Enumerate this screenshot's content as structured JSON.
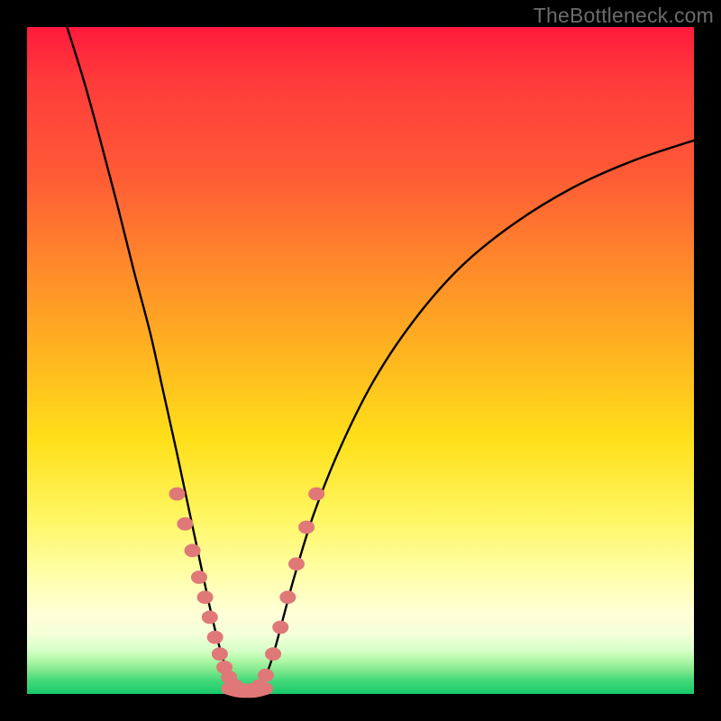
{
  "watermark": "TheBottleneck.com",
  "chart_data": {
    "type": "line",
    "title": "",
    "xlabel": "",
    "ylabel": "",
    "xlim": [
      0,
      1
    ],
    "ylim": [
      0,
      1
    ],
    "gradient_stops": [
      {
        "pos": 0.0,
        "color": "#ff1a3c"
      },
      {
        "pos": 0.22,
        "color": "#ff5a36"
      },
      {
        "pos": 0.5,
        "color": "#ffb81f"
      },
      {
        "pos": 0.73,
        "color": "#fff55e"
      },
      {
        "pos": 0.91,
        "color": "#f4ffd8"
      },
      {
        "pos": 1.0,
        "color": "#18c96a"
      }
    ],
    "series": [
      {
        "name": "left-curve",
        "points": [
          {
            "x": 0.06,
            "y": 1.0
          },
          {
            "x": 0.085,
            "y": 0.92
          },
          {
            "x": 0.11,
            "y": 0.83
          },
          {
            "x": 0.135,
            "y": 0.735
          },
          {
            "x": 0.16,
            "y": 0.635
          },
          {
            "x": 0.185,
            "y": 0.54
          },
          {
            "x": 0.205,
            "y": 0.45
          },
          {
            "x": 0.225,
            "y": 0.36
          },
          {
            "x": 0.242,
            "y": 0.28
          },
          {
            "x": 0.258,
            "y": 0.205
          },
          {
            "x": 0.273,
            "y": 0.135
          },
          {
            "x": 0.286,
            "y": 0.08
          },
          {
            "x": 0.298,
            "y": 0.04
          },
          {
            "x": 0.31,
            "y": 0.015
          },
          {
            "x": 0.322,
            "y": 0.005
          }
        ]
      },
      {
        "name": "right-curve",
        "points": [
          {
            "x": 0.345,
            "y": 0.005
          },
          {
            "x": 0.355,
            "y": 0.02
          },
          {
            "x": 0.368,
            "y": 0.055
          },
          {
            "x": 0.383,
            "y": 0.11
          },
          {
            "x": 0.402,
            "y": 0.18
          },
          {
            "x": 0.43,
            "y": 0.27
          },
          {
            "x": 0.47,
            "y": 0.37
          },
          {
            "x": 0.52,
            "y": 0.47
          },
          {
            "x": 0.58,
            "y": 0.56
          },
          {
            "x": 0.65,
            "y": 0.64
          },
          {
            "x": 0.73,
            "y": 0.705
          },
          {
            "x": 0.82,
            "y": 0.76
          },
          {
            "x": 0.91,
            "y": 0.8
          },
          {
            "x": 1.0,
            "y": 0.83
          }
        ]
      },
      {
        "name": "bottom-flat",
        "points": [
          {
            "x": 0.3,
            "y": 0.008
          },
          {
            "x": 0.315,
            "y": 0.004
          },
          {
            "x": 0.33,
            "y": 0.003
          },
          {
            "x": 0.345,
            "y": 0.004
          },
          {
            "x": 0.36,
            "y": 0.008
          }
        ]
      }
    ],
    "markers": {
      "name": "highlight-dots",
      "color": "#e07878",
      "radius_px": 9,
      "points": [
        {
          "x": 0.225,
          "y": 0.3
        },
        {
          "x": 0.237,
          "y": 0.255
        },
        {
          "x": 0.248,
          "y": 0.215
        },
        {
          "x": 0.258,
          "y": 0.175
        },
        {
          "x": 0.267,
          "y": 0.145
        },
        {
          "x": 0.274,
          "y": 0.115
        },
        {
          "x": 0.282,
          "y": 0.085
        },
        {
          "x": 0.289,
          "y": 0.06
        },
        {
          "x": 0.296,
          "y": 0.04
        },
        {
          "x": 0.303,
          "y": 0.025
        },
        {
          "x": 0.312,
          "y": 0.012
        },
        {
          "x": 0.324,
          "y": 0.006
        },
        {
          "x": 0.336,
          "y": 0.006
        },
        {
          "x": 0.348,
          "y": 0.012
        },
        {
          "x": 0.358,
          "y": 0.028
        },
        {
          "x": 0.369,
          "y": 0.06
        },
        {
          "x": 0.38,
          "y": 0.1
        },
        {
          "x": 0.391,
          "y": 0.145
        },
        {
          "x": 0.404,
          "y": 0.195
        },
        {
          "x": 0.419,
          "y": 0.25
        },
        {
          "x": 0.434,
          "y": 0.3
        }
      ]
    }
  }
}
